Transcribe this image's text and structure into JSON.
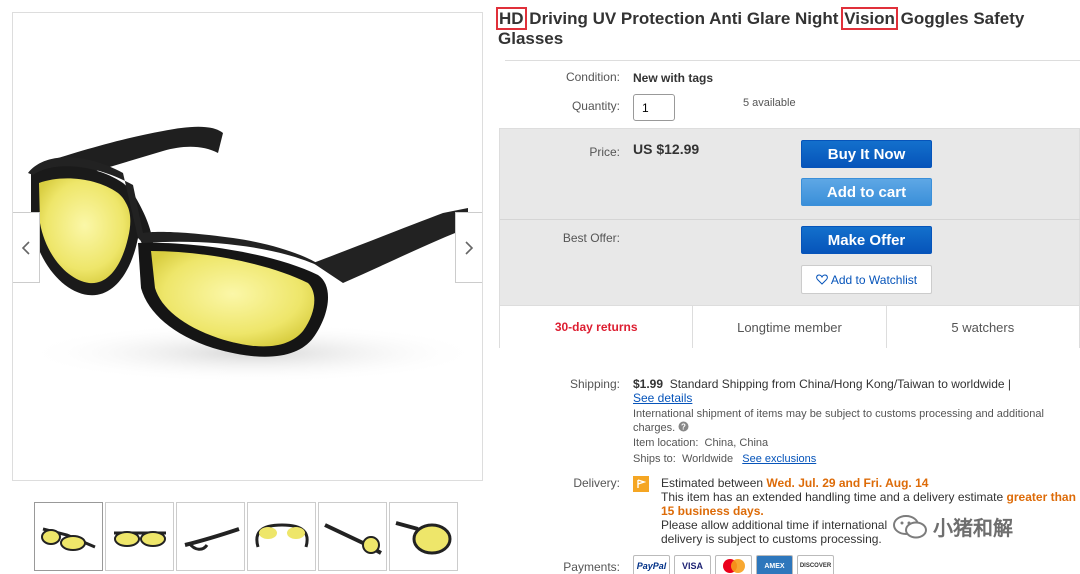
{
  "product": {
    "title_hl1": "HD",
    "title_mid": " Driving UV Protection Anti Glare Night ",
    "title_hl2": "Vision",
    "title_end": " Goggles Safety Glasses"
  },
  "condition": {
    "label": "Condition:",
    "value": "New with tags"
  },
  "quantity": {
    "label": "Quantity:",
    "value": "1",
    "available": "5 available"
  },
  "price": {
    "label": "Price:",
    "value": "US $12.99"
  },
  "buttons": {
    "buy_now": "Buy It Now",
    "add_to_cart": "Add to cart",
    "make_offer": "Make Offer",
    "watchlist": "Add to Watchlist"
  },
  "best_offer": {
    "label": "Best Offer:"
  },
  "stats": {
    "returns": "30-day returns",
    "member": "Longtime member",
    "watchers": "5 watchers"
  },
  "shipping": {
    "label": "Shipping:",
    "cost": "$1.99",
    "method": "Standard Shipping from China/Hong Kong/Taiwan to worldwide |",
    "details_link": "See details",
    "customs_note": "International shipment of items may be subject to customs processing and additional charges.",
    "location_label": "Item location:",
    "location": "China, China",
    "ships_to_label": "Ships to:",
    "ships_to": "Worldwide",
    "exclusions_link": "See exclusions"
  },
  "delivery": {
    "label": "Delivery:",
    "estimated_prefix": "Estimated between",
    "dates": "Wed. Jul. 29 and Fri. Aug. 14",
    "handling_note": "This item has an extended handling time and a delivery estimate",
    "greater_than": "greater than 15 business days.",
    "allow_note": "Please allow additional time if international delivery is subject to customs processing."
  },
  "payments": {
    "label": "Payments:",
    "methods": [
      "PayPal",
      "VISA",
      "MC",
      "AMEX",
      "DISCOVER"
    ]
  },
  "watermark": {
    "text": "小猪和解"
  },
  "colors": {
    "primary_button": "#0654ba",
    "secondary_button": "#3a8fd9",
    "red": "#dd1e31",
    "orange": "#dd6b08",
    "highlight": "#e0303a"
  },
  "icons": {
    "prev": "chevron-left-icon",
    "next": "chevron-right-icon",
    "heart": "heart-icon",
    "help": "question-icon",
    "flag": "flag-icon"
  }
}
